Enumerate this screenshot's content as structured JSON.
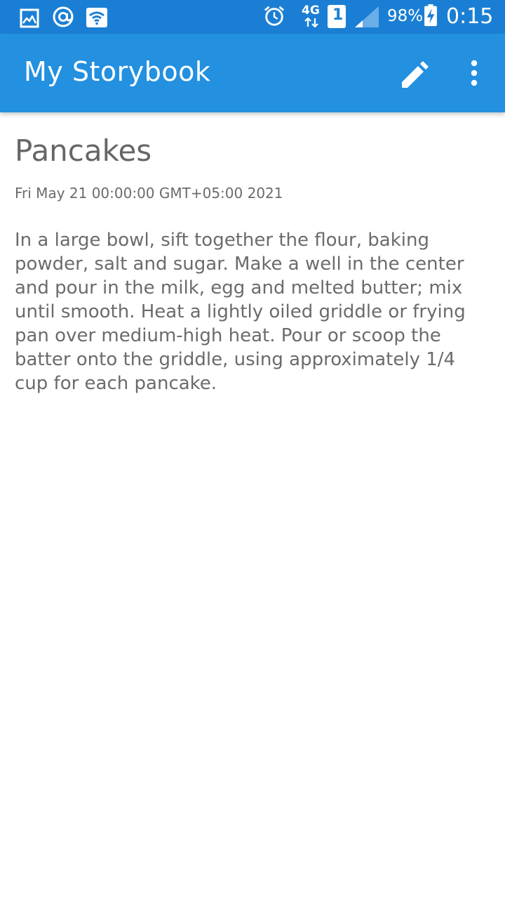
{
  "status_bar": {
    "battery": "98%",
    "time": "0:15",
    "network": "4G",
    "sim_slot": "1",
    "icons": [
      "gallery-icon",
      "at-sign-icon",
      "wifi-icon",
      "alarm-icon",
      "network-4g-icon",
      "sim-1-icon",
      "signal-icon",
      "battery-charging-icon"
    ]
  },
  "app_bar": {
    "title": "My Storybook",
    "actions": [
      "edit-icon",
      "more-options-icon"
    ]
  },
  "story": {
    "title": "Pancakes",
    "date": "Fri May 21 00:00:00 GMT+05:00 2021",
    "body": "In a large bowl, sift together the flour, baking powder, salt and sugar. Make a well in the center and pour in the milk, egg and melted butter; mix until smooth. Heat a lightly oiled griddle or frying pan over medium-high heat. Pour or scoop the batter onto the griddle, using approximately 1/4 cup for each pancake."
  },
  "colors": {
    "status_bar": "#1a7fd4",
    "app_bar": "#2390e0",
    "text": "#6b6b6b"
  }
}
